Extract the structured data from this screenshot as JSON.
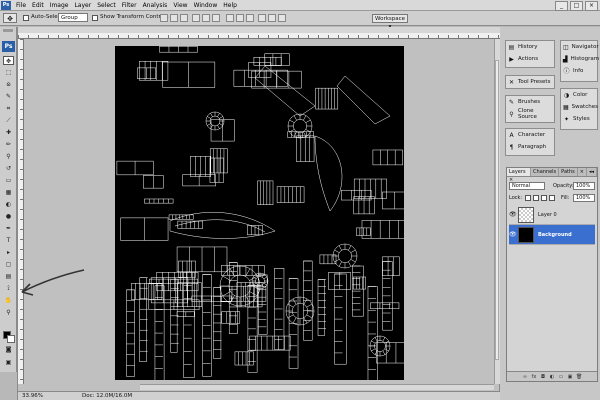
{
  "menu": {
    "app_badge": "Ps",
    "items": [
      "File",
      "Edit",
      "Image",
      "Layer",
      "Select",
      "Filter",
      "Analysis",
      "View",
      "Window",
      "Help"
    ],
    "window_controls": [
      "_",
      "□",
      "×"
    ]
  },
  "options_bar": {
    "tool_icon": "move-tool-icon",
    "tool_glyph": "✥",
    "auto_select_label": "Auto-Select:",
    "auto_select_value": "Group",
    "transform_label": "Show Transform Controls",
    "workspace_label": "Workspace ▾"
  },
  "tools": {
    "logo": "Ps",
    "items": [
      {
        "name": "move-tool",
        "glyph": "✥",
        "selected": true
      },
      {
        "name": "marquee-tool",
        "glyph": "⬚"
      },
      {
        "name": "lasso-tool",
        "glyph": "ɷ"
      },
      {
        "name": "quick-select-tool",
        "glyph": "✎"
      },
      {
        "name": "crop-tool",
        "glyph": "⌗"
      },
      {
        "name": "slice-tool",
        "glyph": "⟋"
      },
      {
        "name": "healing-tool",
        "glyph": "✚"
      },
      {
        "name": "brush-tool",
        "glyph": "✏"
      },
      {
        "name": "stamp-tool",
        "glyph": "⚲"
      },
      {
        "name": "history-brush-tool",
        "glyph": "↺"
      },
      {
        "name": "eraser-tool",
        "glyph": "▭"
      },
      {
        "name": "gradient-tool",
        "glyph": "▦"
      },
      {
        "name": "blur-tool",
        "glyph": "◐"
      },
      {
        "name": "dodge-tool",
        "glyph": "●"
      },
      {
        "name": "pen-tool",
        "glyph": "✒"
      },
      {
        "name": "type-tool",
        "glyph": "T"
      },
      {
        "name": "path-select-tool",
        "glyph": "▸"
      },
      {
        "name": "shape-tool",
        "glyph": "▢"
      },
      {
        "name": "notes-tool",
        "glyph": "▤"
      },
      {
        "name": "eyedropper-tool",
        "glyph": "⟟"
      },
      {
        "name": "hand-tool",
        "glyph": "✋"
      },
      {
        "name": "zoom-tool",
        "glyph": "⚲"
      }
    ],
    "quick_mask_glyph": "◙",
    "screen_mode_glyph": "▣"
  },
  "status": {
    "zoom": "33.96%",
    "doc": "Doc: 12.0M/16.0M"
  },
  "dock": {
    "col1": [
      {
        "label": "History",
        "icon": "history-icon",
        "glyph": "▤"
      },
      {
        "label": "Actions",
        "icon": "actions-icon",
        "glyph": "▶"
      },
      {
        "label": "Tool Presets",
        "icon": "tool-presets-icon",
        "glyph": "✕"
      },
      {
        "label": "Brushes",
        "icon": "brushes-icon",
        "glyph": "✎"
      },
      {
        "label": "Clone Source",
        "icon": "clone-source-icon",
        "glyph": "⚲"
      },
      {
        "label": "Character",
        "icon": "character-icon",
        "glyph": "A"
      },
      {
        "label": "Paragraph",
        "icon": "paragraph-icon",
        "glyph": "¶"
      }
    ],
    "col2": [
      {
        "label": "Navigator",
        "icon": "navigator-icon",
        "glyph": "◫"
      },
      {
        "label": "Histogram",
        "icon": "histogram-icon",
        "glyph": "▟"
      },
      {
        "label": "Info",
        "icon": "info-icon",
        "glyph": "ⓘ"
      },
      {
        "label": "Color",
        "icon": "color-icon",
        "glyph": "◑"
      },
      {
        "label": "Swatches",
        "icon": "swatches-icon",
        "glyph": "▦"
      },
      {
        "label": "Styles",
        "icon": "styles-icon",
        "glyph": "✦"
      }
    ]
  },
  "layers": {
    "tabs": [
      "Layers ×",
      "Channels",
      "Paths",
      "×",
      "◂◂"
    ],
    "blend_mode": "Normal",
    "opacity_label": "Opacity:",
    "opacity_value": "100%",
    "lock_label": "Lock:",
    "fill_label": "Fill:",
    "fill_value": "100%",
    "rows": [
      {
        "name": "Layer 0",
        "selected": false
      },
      {
        "name": "Background",
        "selected": true
      }
    ],
    "footer": [
      "∞",
      "fx",
      "◘",
      "◐",
      "▭",
      "▣",
      "🗑"
    ],
    "selection_color": "#3a6fd0"
  },
  "canvas": {
    "background": "#000000",
    "line_color": "#ffffff"
  }
}
